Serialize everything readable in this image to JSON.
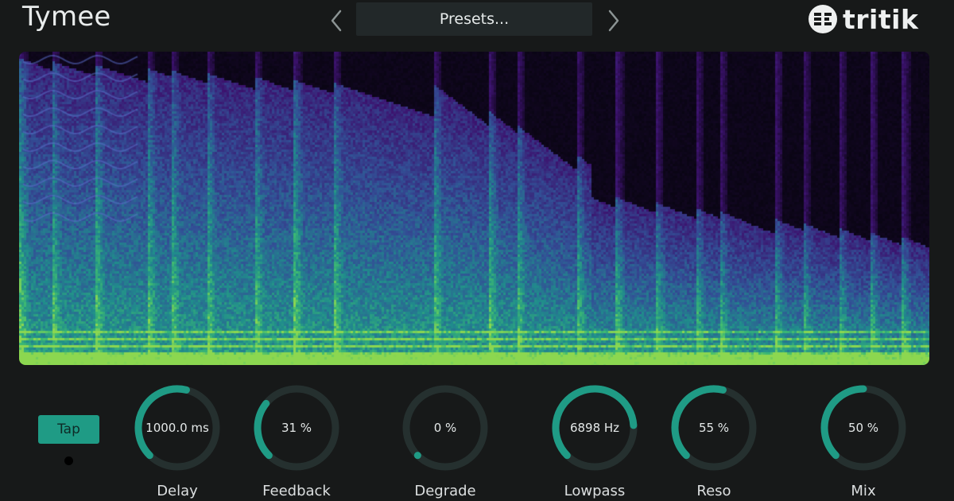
{
  "app": {
    "title": "Tymee"
  },
  "header": {
    "preset_label": "Presets...",
    "brand_name": "tritik"
  },
  "controls": {
    "tap_label": "Tap",
    "knobs": [
      {
        "name": "delay",
        "label": "Delay",
        "value": "1000.0 ms",
        "level": 0.55
      },
      {
        "name": "feedback",
        "label": "Feedback",
        "value": "31 %",
        "level": 0.31
      },
      {
        "name": "degrade",
        "label": "Degrade",
        "value": "0 %",
        "level": 0.0
      },
      {
        "name": "lowpass",
        "label": "Lowpass",
        "value": "6898 Hz",
        "level": 0.82
      },
      {
        "name": "reso",
        "label": "Reso",
        "value": "55 %",
        "level": 0.55
      },
      {
        "name": "mix",
        "label": "Mix",
        "value": "50 %",
        "level": 0.5
      }
    ]
  },
  "colors": {
    "accent": "#1f9b85",
    "knob_track": "#25302f",
    "spectrum_low": "#3b0f70",
    "spectrum_mid": "#1f8d8c",
    "spectrum_high": "#7ad151"
  }
}
